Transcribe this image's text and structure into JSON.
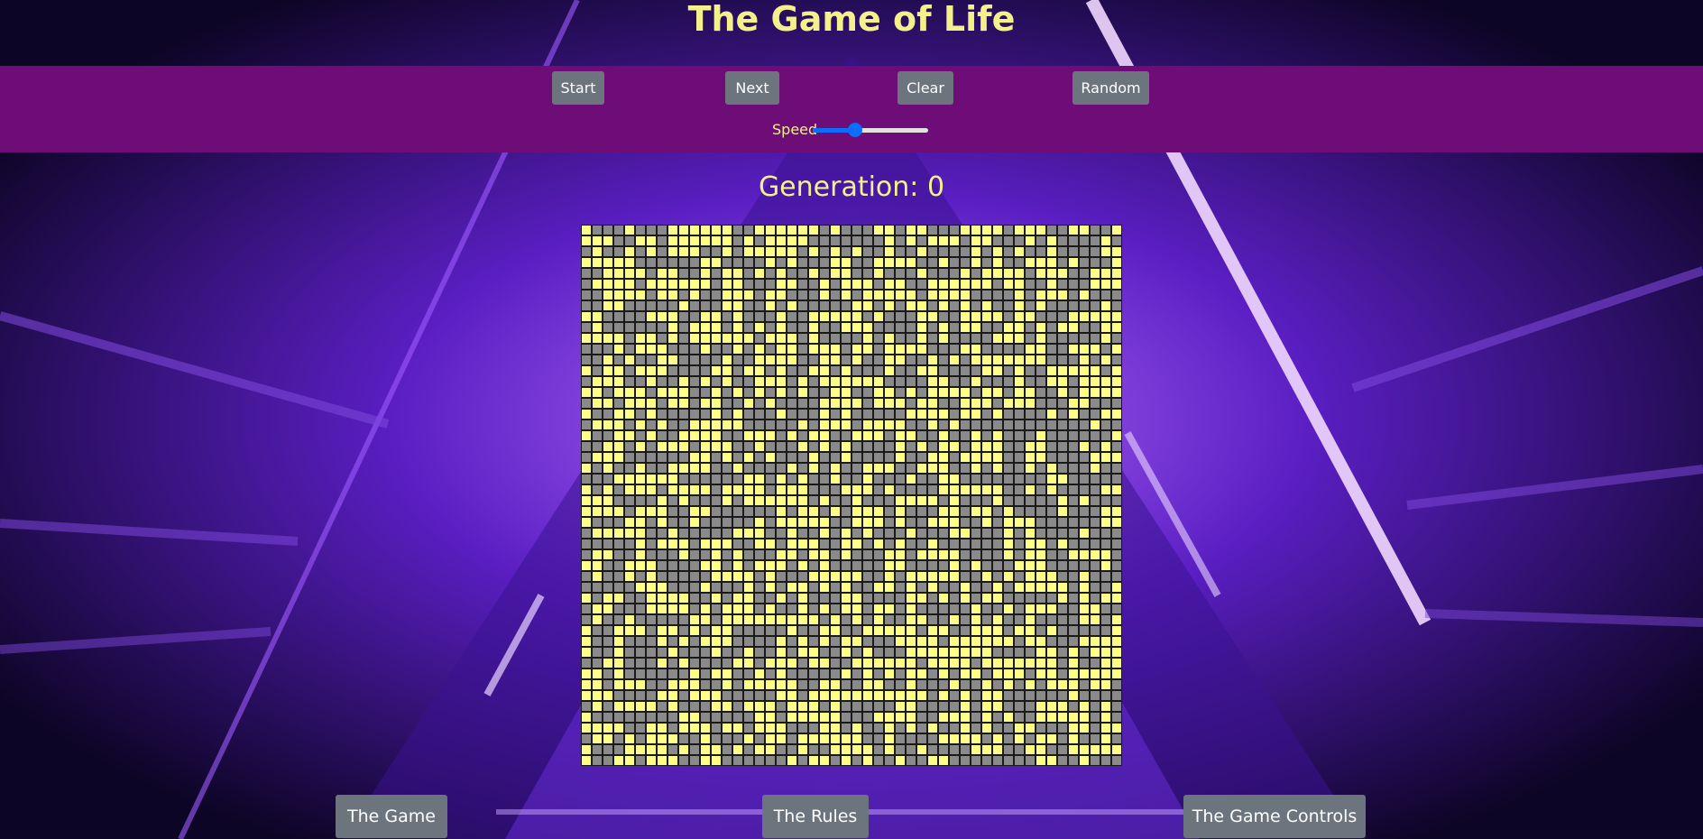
{
  "page": {
    "title": "The Game of Life"
  },
  "toolbar": {
    "start_label": "Start",
    "next_label": "Next",
    "clear_label": "Clear",
    "random_label": "Random",
    "speed_label": "Speed",
    "speed_value": 0.35
  },
  "generation": {
    "label": "Generation:",
    "value": "0"
  },
  "grid": {
    "rows": 50,
    "cols": 50,
    "alive_color": "#ffff88",
    "dead_color": "#8a8a8a"
  },
  "nav": {
    "game_label": "The Game",
    "rules_label": "The Rules",
    "controls_label": "The Game Controls"
  },
  "colors": {
    "accent_text": "#f4f18a",
    "toolbar_bg": "#6e0c78",
    "button_bg": "#6c757d",
    "slider_accent": "#0d6efd"
  }
}
